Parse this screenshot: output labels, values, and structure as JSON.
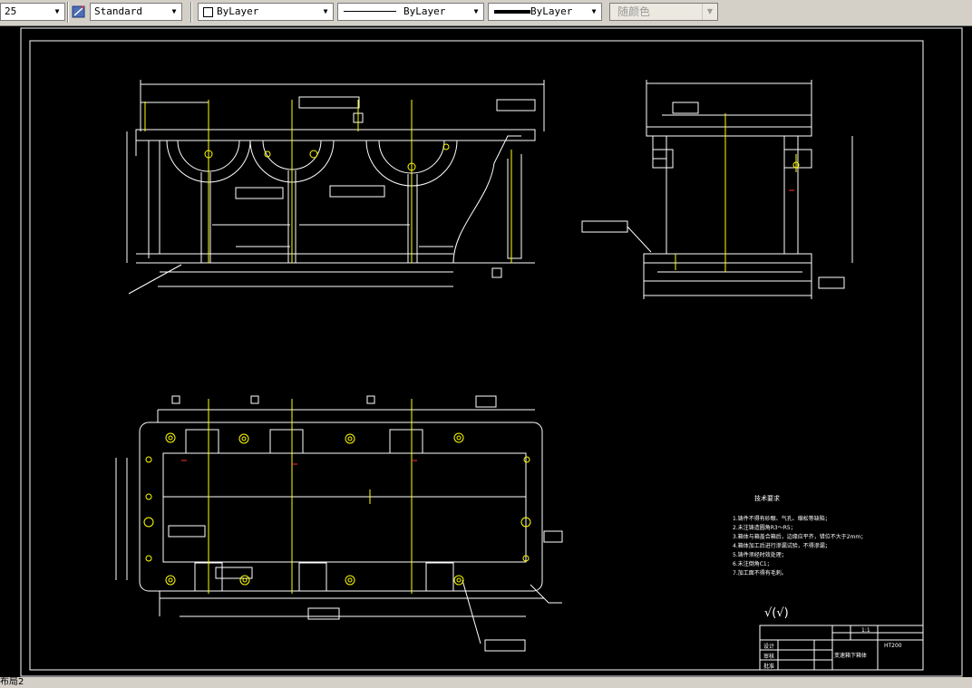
{
  "toolbar": {
    "textstyle_partial": "25",
    "dimstyle_value": "Standard",
    "layer_value": "ByLayer",
    "linetype_value": "ByLayer",
    "lineweight_value": "ByLayer",
    "plotstyle_value": "随颜色",
    "colors": {
      "bg": "#d4d0c8",
      "canvas": "#000000"
    }
  },
  "drawing": {
    "title_block": {
      "material": "HT200",
      "scale": "1:1",
      "name": "变速箱下箱体",
      "row_design": "设计",
      "row_check": "审核",
      "row_approve": "批准"
    },
    "notes_title": "技术要求",
    "notes": [
      "1.铸件不得有砂眼、气孔、缩松等缺陷；",
      "2.未注铸造圆角R3～R5；",
      "3.箱体与箱盖合箱后，边缘应平齐，错位不大于2mm；",
      "4.箱体加工后进行渗漏试验，不得渗漏；",
      "5.铸件须经时效处理；",
      "6.未注倒角C1；",
      "7.加工面不得有毛刺。"
    ],
    "roughness_mark": "√(√)"
  },
  "statusbar": {
    "layout_tab": "布局2"
  }
}
